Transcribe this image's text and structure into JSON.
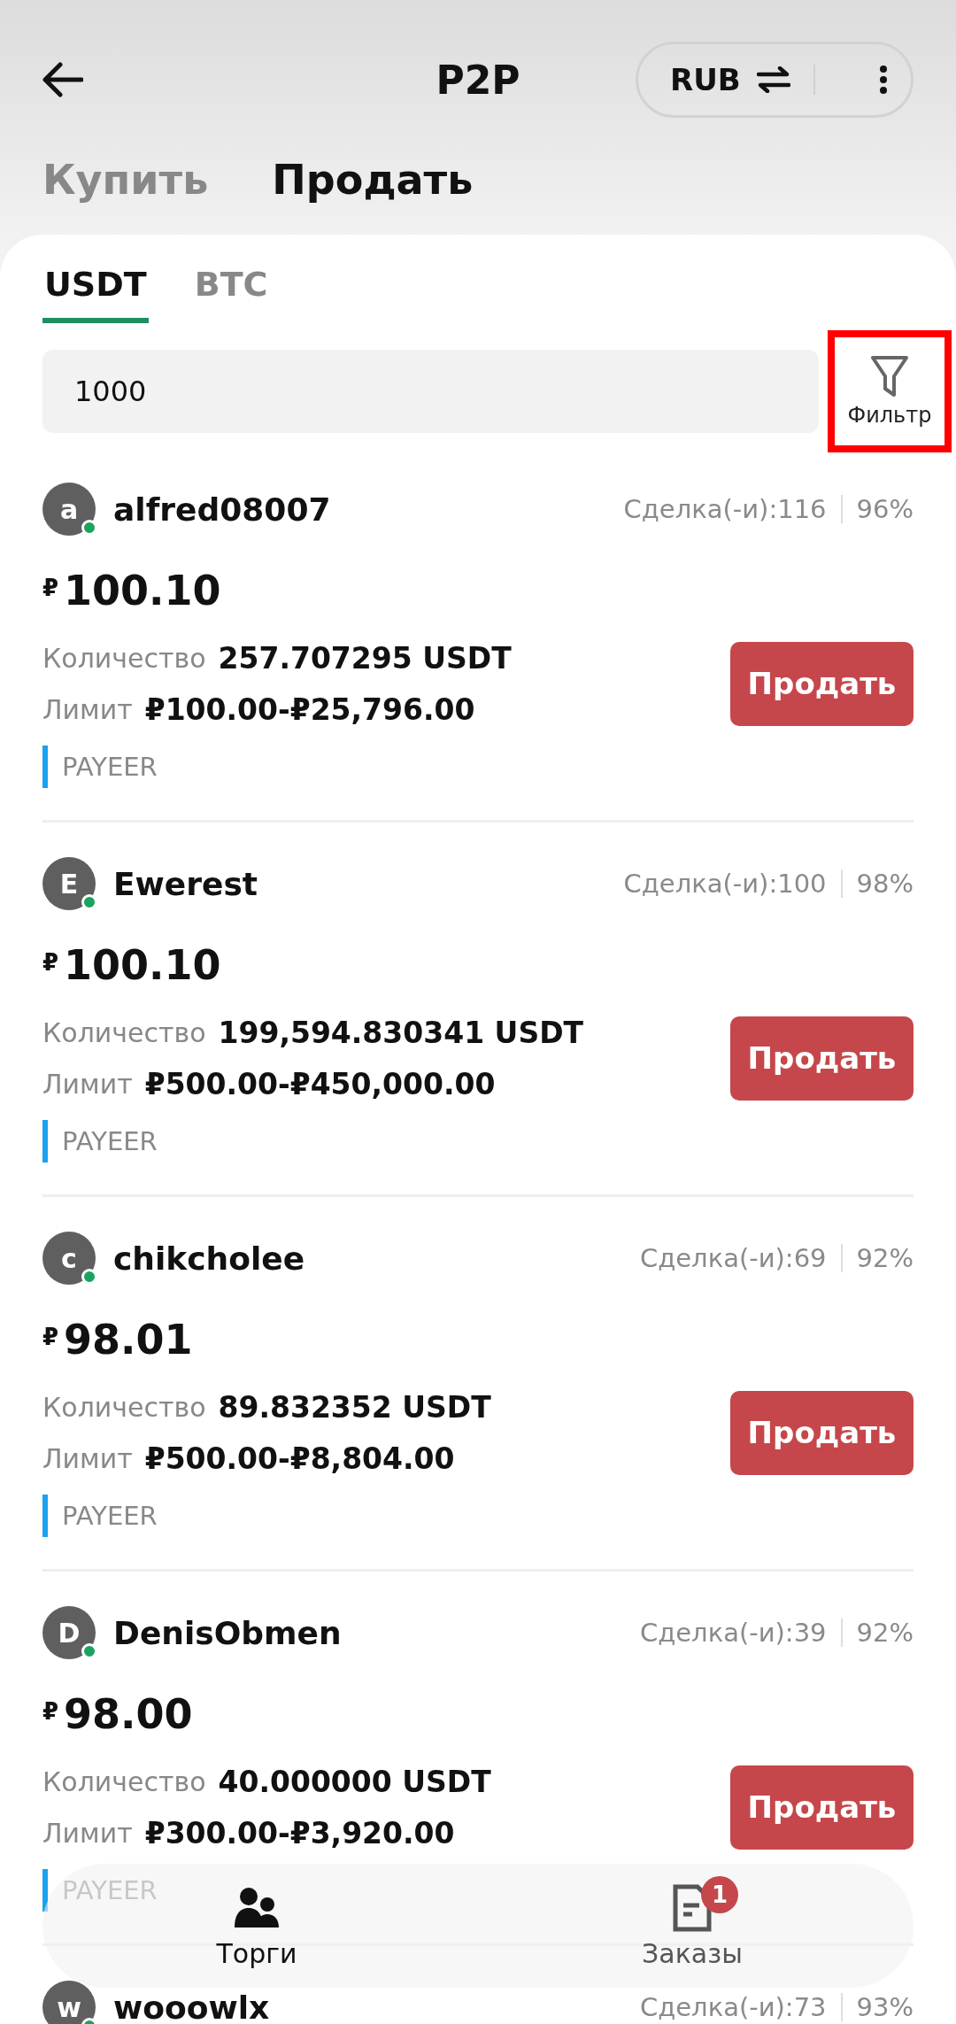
{
  "header": {
    "title": "P2P",
    "currency": "RUB"
  },
  "trade_tabs": [
    {
      "label": "Купить",
      "selected": false
    },
    {
      "label": "Продать",
      "selected": true
    }
  ],
  "coin_tabs": [
    {
      "label": "USDT",
      "selected": true
    },
    {
      "label": "BTC",
      "selected": false
    }
  ],
  "amount_field": {
    "value": "1000"
  },
  "filter": {
    "label": "Фильтр",
    "highlighted": true
  },
  "listings": [
    {
      "avatar": "a",
      "name": "alfred08007",
      "online": true,
      "trades": "Сделка(-и):116",
      "rate": "96%",
      "currency_sign": "₽",
      "price": "100.10",
      "quantity_label": "Количество",
      "quantity": "257.707295 USDT",
      "limit_label": "Лимит",
      "limit": "₽100.00-₽25,796.00",
      "payment": "PAYEER",
      "button": "Продать"
    },
    {
      "avatar": "E",
      "name": "Ewerest",
      "online": true,
      "trades": "Сделка(-и):100",
      "rate": "98%",
      "currency_sign": "₽",
      "price": "100.10",
      "quantity_label": "Количество",
      "quantity": "199,594.830341 USDT",
      "limit_label": "Лимит",
      "limit": "₽500.00-₽450,000.00",
      "payment": "PAYEER",
      "button": "Продать"
    },
    {
      "avatar": "c",
      "name": "chikcholee",
      "online": true,
      "trades": "Сделка(-и):69",
      "rate": "92%",
      "currency_sign": "₽",
      "price": "98.01",
      "quantity_label": "Количество",
      "quantity": "89.832352 USDT",
      "limit_label": "Лимит",
      "limit": "₽500.00-₽8,804.00",
      "payment": "PAYEER",
      "button": "Продать"
    },
    {
      "avatar": "D",
      "name": "DenisObmen",
      "online": true,
      "trades": "Сделка(-и):39",
      "rate": "92%",
      "currency_sign": "₽",
      "price": "98.00",
      "quantity_label": "Количество",
      "quantity": "40.000000 USDT",
      "limit_label": "Лимит",
      "limit": "₽300.00-₽3,920.00",
      "payment": "PAYEER",
      "button": "Продать"
    },
    {
      "avatar": "w",
      "name": "wooowlx",
      "online": true,
      "trades": "Сделка(-и):73",
      "rate": "93%"
    }
  ],
  "bottom_nav": [
    {
      "label": "Торги",
      "selected": true
    },
    {
      "label": "Заказы",
      "selected": false,
      "badge": "1"
    }
  ]
}
